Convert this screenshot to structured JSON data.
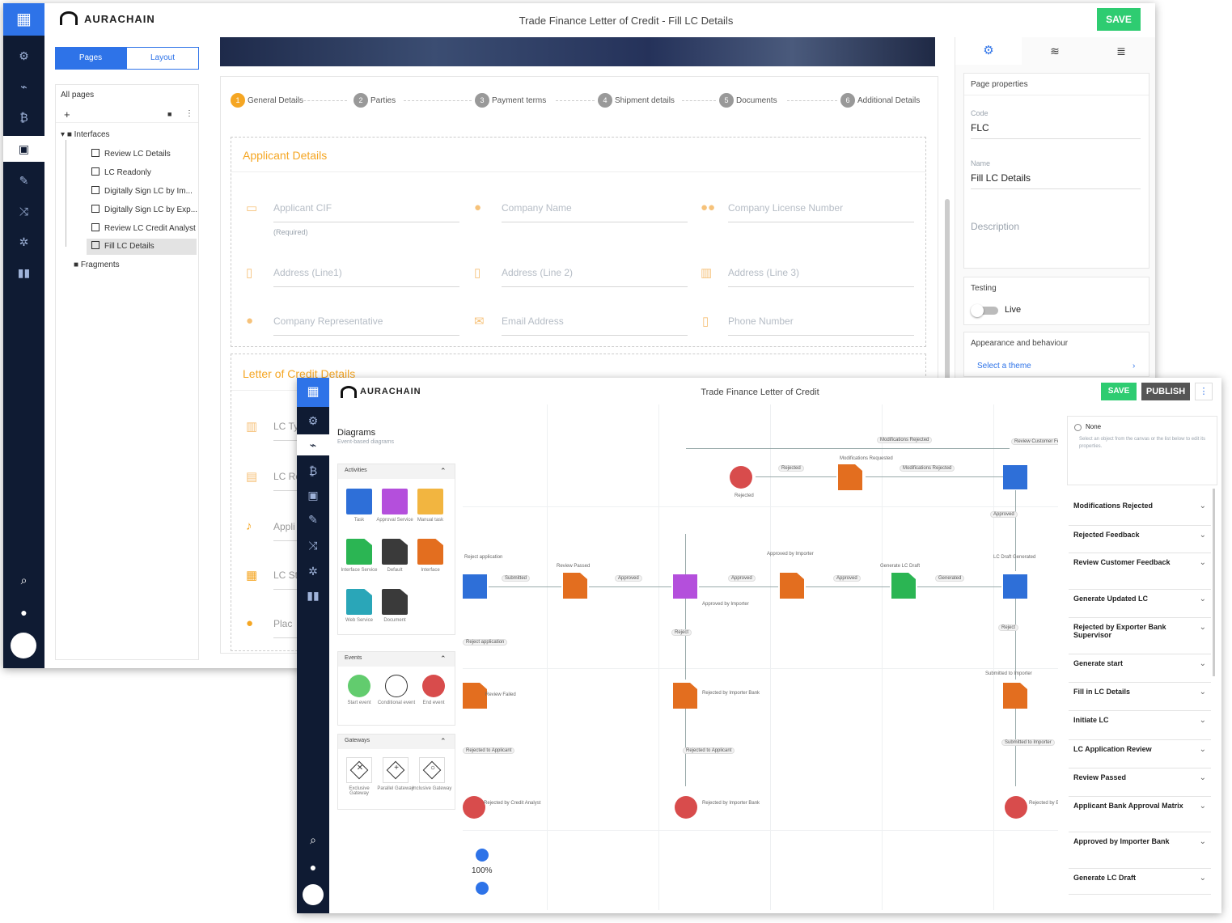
{
  "back": {
    "brand": "AURACHAIN",
    "title": "Trade Finance Letter of Credit  -  Fill LC Details",
    "save": "SAVE",
    "tabs": [
      "Pages",
      "Layout"
    ],
    "all_pages": "All pages",
    "tree": {
      "interfaces": "Interfaces",
      "items": [
        "Review LC Details",
        "LC Readonly",
        "Digitally Sign LC by Im...",
        "Digitally Sign LC by Exp...",
        "Review LC Credit Analyst",
        "Fill LC Details"
      ],
      "fragments": "Fragments"
    },
    "steps": [
      {
        "n": "1",
        "label": "General Details"
      },
      {
        "n": "2",
        "label": "Parties"
      },
      {
        "n": "3",
        "label": "Payment terms"
      },
      {
        "n": "4",
        "label": "Shipment details"
      },
      {
        "n": "5",
        "label": "Documents"
      },
      {
        "n": "6",
        "label": "Additional Details"
      }
    ],
    "section1": "Applicant Details",
    "fields": [
      "Applicant CIF",
      "Company Name",
      "Company License Number",
      "Address (Line1)",
      "Address (Line 2)",
      "Address (Line 3)",
      "Company Representative",
      "Email Address",
      "Phone Number"
    ],
    "required": "(Required)",
    "section2": "Letter of Credit Details",
    "lc_fields": [
      "LC Ty",
      "LC Re",
      "Appli",
      "LC St",
      "Plac"
    ],
    "props": {
      "page_properties": "Page properties",
      "code_label": "Code",
      "code_value": "FLC",
      "name_label": "Name",
      "name_value": "Fill LC Details",
      "description": "Description",
      "testing": "Testing",
      "live": "Live",
      "appearance": "Appearance and behaviour",
      "select_theme": "Select a theme"
    }
  },
  "front": {
    "brand": "AURACHAIN",
    "title": "Trade Finance Letter of Credit",
    "save": "SAVE",
    "publish": "PUBLISH",
    "more": "⋮",
    "diagrams_title": "Diagrams",
    "diagrams_sub": "Event-based diagrams",
    "palette_groups": [
      {
        "title": "Activities",
        "items": [
          {
            "color": "#2e6fd8",
            "shape": "square",
            "label": "Task"
          },
          {
            "color": "#b44fdc",
            "shape": "square",
            "label": "Approval Service"
          },
          {
            "color": "#f2b540",
            "shape": "square",
            "label": "Manual task"
          },
          {
            "color": "#2bb553",
            "shape": "doc",
            "label": "Interface Service"
          },
          {
            "color": "#3a3a3a",
            "shape": "doc",
            "label": "Default"
          },
          {
            "color": "#e36e1f",
            "shape": "doc",
            "label": "Interface"
          },
          {
            "color": "#2aa6b8",
            "shape": "doc",
            "label": "Web Service"
          },
          {
            "color": "#3a3a3a",
            "shape": "doc",
            "label": "Document"
          }
        ]
      },
      {
        "title": "Events",
        "items": [
          {
            "color": "#62cc6e",
            "shape": "circle",
            "label": "Start event"
          },
          {
            "color": "#ffffff",
            "shape": "circle",
            "label": "Conditional event"
          },
          {
            "color": "#d84c4c",
            "shape": "circle",
            "label": "End event"
          }
        ]
      },
      {
        "title": "Gateways",
        "items": [
          {
            "glyph": "✕",
            "label": "Exclusive Gateway"
          },
          {
            "glyph": "+",
            "label": "Parallel Gateway"
          },
          {
            "glyph": "○",
            "label": "Inclusive Gateway"
          }
        ]
      }
    ],
    "zoom": "100%",
    "none_box": {
      "title": "None",
      "text": "Select an object from the canvas or the list below to edit its properties."
    },
    "accordions": [
      "Modifications Rejected",
      "Rejected Feedback",
      "Review Customer Feedback",
      "Generate Updated LC",
      "Rejected by Exporter Bank Supervisor",
      "Generate start",
      "Fill in LC Details",
      "Initiate LC",
      "LC Application Review",
      "Review Passed",
      "Applicant Bank Approval Matrix",
      "Approved by Importer Bank",
      "Generate LC Draft"
    ],
    "canvas_labels": [
      "Modifications Rejected",
      "Rejected",
      "Modifications Requested",
      "Review Customer Feedback",
      "Modifications Rejected",
      "Submitted",
      "Review Passed",
      "Approved by Importer",
      "Generate LC Draft",
      "LC Draft Generated",
      "Approved",
      "Generated",
      "Reject",
      "Rejected by Importer Bank",
      "Submitted to Importer",
      "Rejected by Credit Analyst",
      "Review Failed",
      "Rejected to Applicant",
      "Rejected by Importer Bank",
      "Submitted to Importer",
      "Rejected by Exporter",
      "Reject application"
    ]
  },
  "colors": {
    "rail": "#0f1b33",
    "accent": "#2e73e8",
    "orange": "#f5a623",
    "green": "#2ecc71"
  }
}
